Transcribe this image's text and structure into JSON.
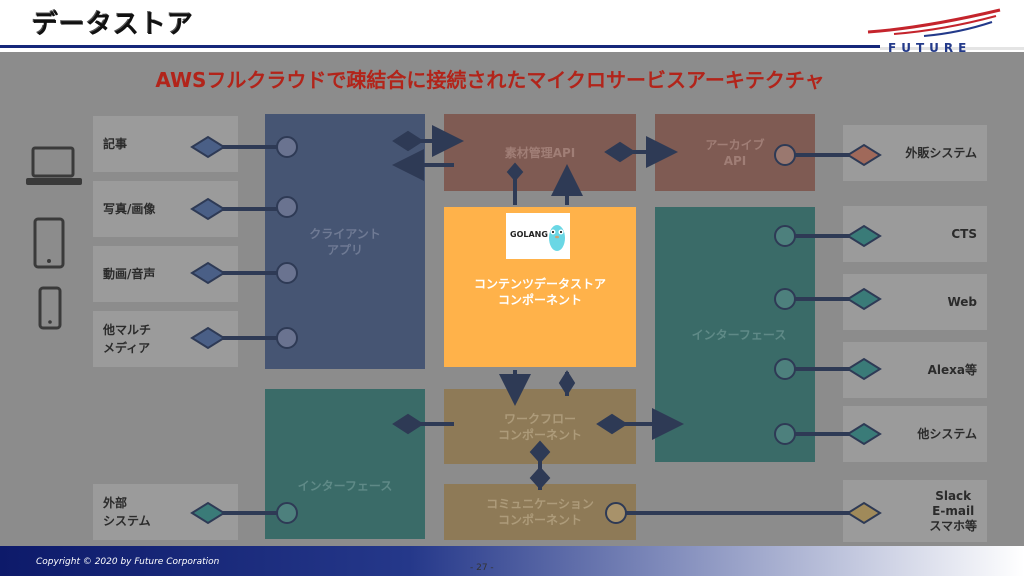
{
  "title": "データストア",
  "logo": {
    "word": "FUTURE"
  },
  "headline": "AWSフルクラウドで疎結合に接続されたマイクロサービスアーキテクチャ",
  "left_items": [
    {
      "label": "記事"
    },
    {
      "label": "写真/画像"
    },
    {
      "label": "動画/音声"
    },
    {
      "label": "他マルチ\nメディア"
    },
    {
      "label": "外部\nシステム"
    }
  ],
  "blocks": {
    "client_app": "クライアント\nアプリ",
    "interface_left": "インターフェース",
    "material_api": "素材管理API",
    "archive_api": "アーカイブ\nAPI",
    "content_store": "コンテンツデータストア\nコンポーネント",
    "workflow": "ワークフロー\nコンポーネント",
    "communication": "コミュニケーション\nコンポーネント",
    "interface_right": "インターフェース",
    "golang_badge": "GOLANG"
  },
  "right_items": [
    {
      "label": "外販システム"
    },
    {
      "label": "CTS"
    },
    {
      "label": "Web"
    },
    {
      "label": "Alexa等"
    },
    {
      "label": "他システム"
    },
    {
      "label": "Slack\nE-mail\nスマホ等"
    }
  ],
  "device_icons": [
    "laptop-icon",
    "tablet-icon",
    "smartphone-icon"
  ],
  "colors": {
    "client_app": "#465573",
    "material_api": "#7f5b53",
    "archive_api": "#7f5b53",
    "content_store": "#ffb24a",
    "workflow": "#8e7a57",
    "communication": "#8e7a57",
    "interface_right": "#3a6b68",
    "interface_left": "#3a6b68",
    "headline": "#b2241a"
  },
  "footer": {
    "copyright": "Copyright © 2020 by Future  Corporation",
    "page": "- 27 -"
  }
}
